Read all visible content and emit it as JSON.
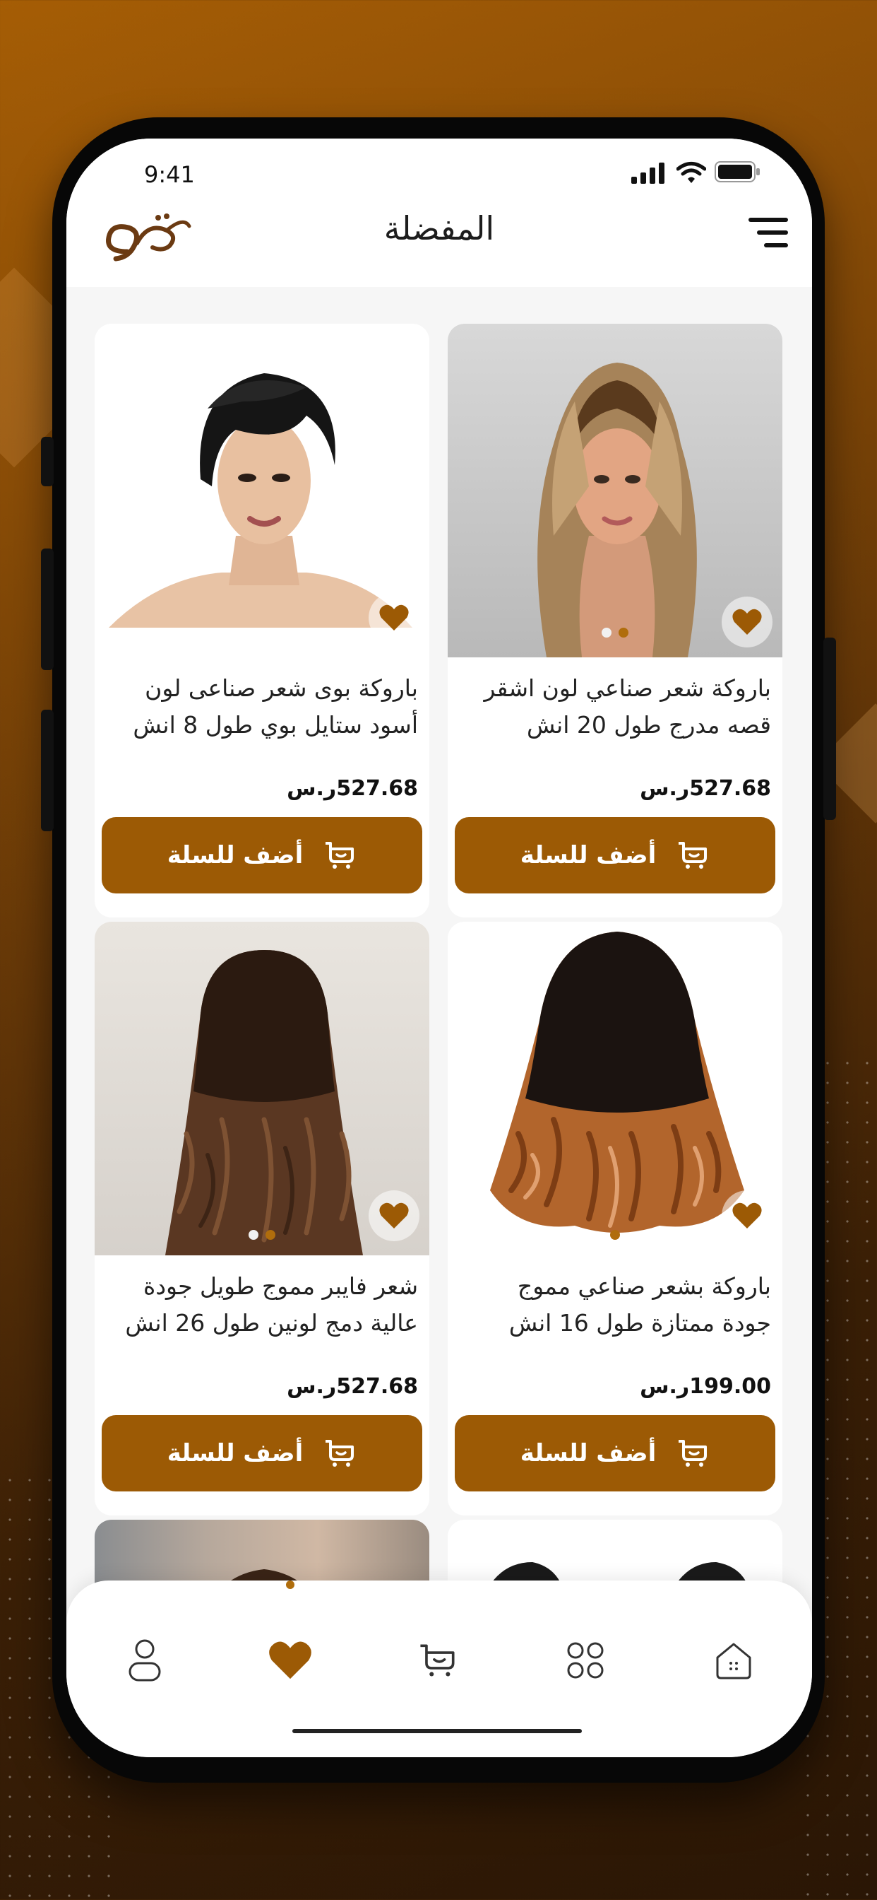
{
  "status_bar": {
    "time": "9:41"
  },
  "header": {
    "title": "المفضلة",
    "logo_icon": "brand-logo-icon",
    "menu_icon": "menu-icon"
  },
  "colors": {
    "accent": "#9c5a05",
    "background": "#f6f6f6",
    "card": "#ffffff"
  },
  "products": [
    {
      "name": "باروكة شعر صناعي لون اشقر قصه مدرج طول 20 انش",
      "price": "527.68ر.س",
      "add_label": "أضف للسلة",
      "image_icon": "blonde-layered-wig-image",
      "pager": [
        false,
        true
      ]
    },
    {
      "name": "باروكة بوى شعر صناعى لون أسود ستايل بوي طول 8 انش",
      "price": "527.68ر.س",
      "add_label": "أضف للسلة",
      "image_icon": "black-short-wig-image",
      "pager": []
    },
    {
      "name": "باروكة بشعر صناعي مموج جودة ممتازة طول 16 انش",
      "price": "199.00ر.س",
      "add_label": "أضف للسلة",
      "image_icon": "ombre-curly-wig-image",
      "pager": [
        true
      ]
    },
    {
      "name": "شعر فايبر مموج طويل جودة عالية دمج لونين طول 26 انش",
      "price": "527.68ر.س",
      "add_label": "أضف للسلة",
      "image_icon": "brown-wavy-wig-image",
      "pager": [
        false,
        true
      ]
    }
  ],
  "bottom_nav": [
    {
      "name": "home",
      "icon": "home-icon",
      "active": false
    },
    {
      "name": "categories",
      "icon": "grid-icon",
      "active": false
    },
    {
      "name": "cart",
      "icon": "cart-icon",
      "active": false
    },
    {
      "name": "favorites",
      "icon": "heart-icon",
      "active": true
    },
    {
      "name": "profile",
      "icon": "user-icon",
      "active": false
    }
  ]
}
